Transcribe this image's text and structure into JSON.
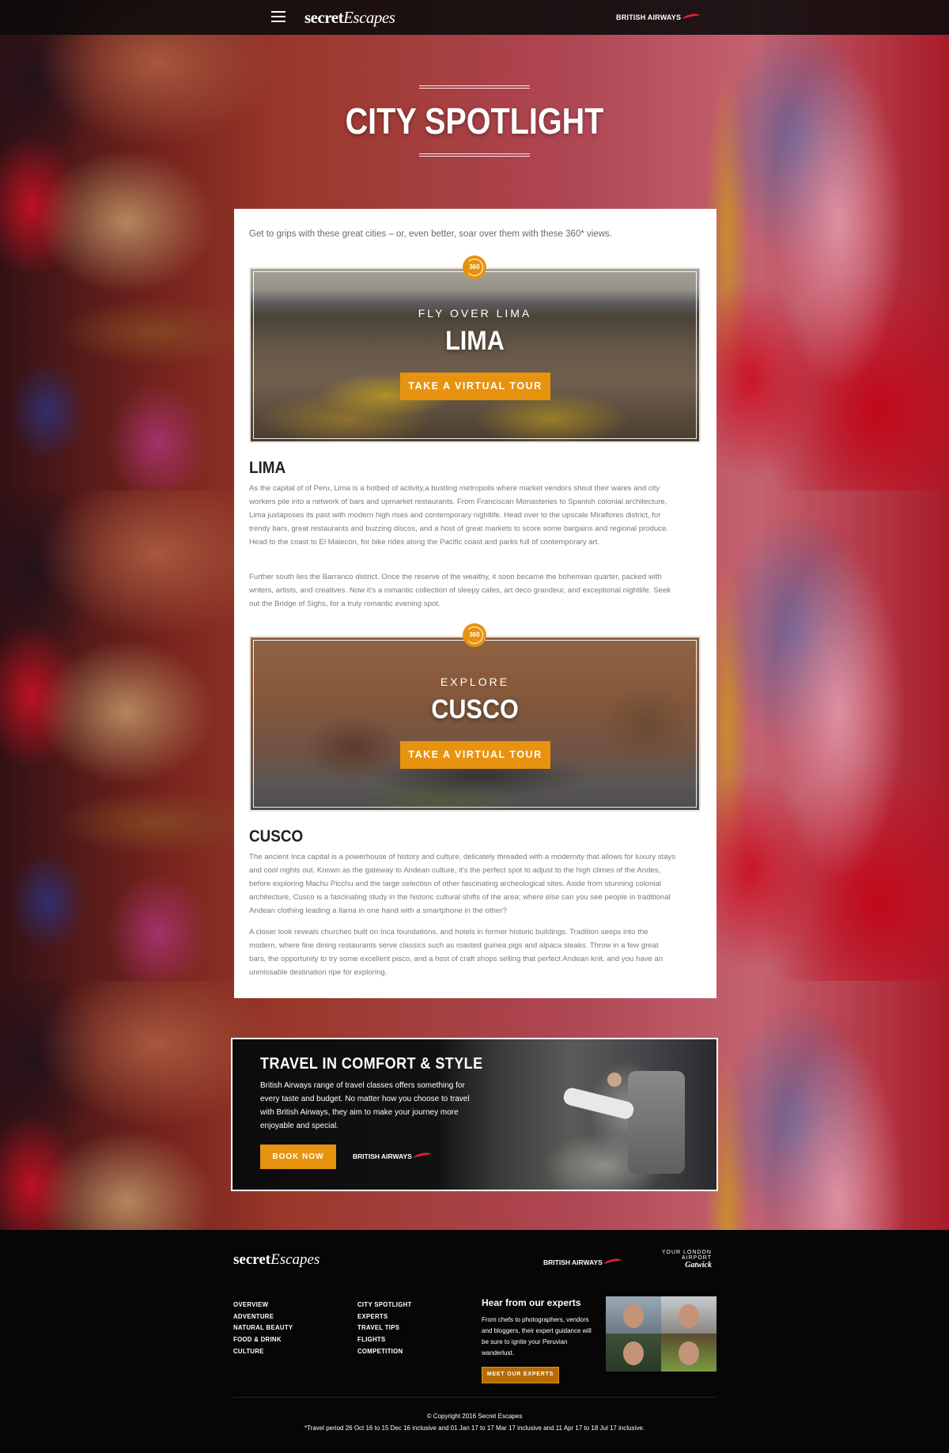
{
  "nav": {
    "brand_bold": "secret",
    "brand_italic": "Escapes",
    "partner_logo": "BRITISH AIRWAYS",
    "menu_icon": "hamburger-menu-icon"
  },
  "hero": {
    "title": "CITY SPOTLIGHT"
  },
  "content": {
    "intro": "Get to grips with these great cities – or, even better, soar over them with these 360* views.",
    "badge_label": "360",
    "lima": {
      "kicker": "FLY OVER LIMA",
      "city": "LIMA",
      "button": "TAKE A VIRTUAL TOUR",
      "heading": "LIMA",
      "para1": "As the capital of of Peru, Lima is a hotbed of activity,a bustling metropolis where market vendors shout their wares and city workers pile into a network of bars and upmarket restaurants. From Franciscan Monasteries to Spanish colonial architecture, Lima juxtaposes its past with modern high rises and contemporary nightlife. Head over to the upscale Miraflores district, for trendy bars, great restaurants and buzzing discos, and a host of great markets to score some bargains and regional produce. Head to the coast to El Malecón, for bike rides along the Pacific coast and parks full of contemporary art.",
      "para2": "Further south lies the Barranco district. Once the reserve of the wealthy, it soon became the bohemian quarter, packed with writers, artists, and creatives. Now it's a romantic collection of sleepy cafes, art deco grandeur, and exceptional nightlife. Seek out the Bridge of Sighs, for a truly romantic evening spot."
    },
    "cusco": {
      "kicker": "EXPLORE",
      "city": "CUSCO",
      "button": "TAKE A VIRTUAL TOUR",
      "heading": "CUSCO",
      "para1": "The ancient Inca capital is a powerhouse of history and culture, delicately threaded with a modernity that allows for luxury stays and cool nights out. Known as the gateway to Andean culture, it's the perfect spot to adjust to the high climes of the Andes, before exploring Machu Picchu and the large selection of other fascinating archeological sites. Aside from stunning colonial architecture, Cusco is a fascinating study in the historic cultural shifts of the area; where else can you see people in traditional Andean clothing leading a llama in one hand with a smartphone in the other?",
      "para2": "A closer look reveals churches built on Inca foundations, and hotels in former historic buildings. Tradition seeps into the modern, where fine dining restaurants serve classics such as roasted guinea pigs and alpaca steaks. Throw in a few great bars, the opportunity to try some excellent pisco, and a host of craft shops selling that perfect Andean knit, and you have an unmissable destination ripe for exploring."
    }
  },
  "promo": {
    "title": "TRAVEL IN COMFORT & STYLE",
    "text": "British Airways range of travel classes offers something for every taste and budget. No matter how you choose to travel with British Airways, they aim to make your journey more enjoyable and special.",
    "button": "BOOK NOW",
    "partner_logo": "BRITISH AIRWAYS"
  },
  "footer": {
    "brand_bold": "secret",
    "brand_italic": "Escapes",
    "partner_logo": "BRITISH AIRWAYS",
    "gatwick_top": "YOUR LONDON AIRPORT",
    "gatwick_bottom": "Gatwick",
    "col1": [
      "OVERVIEW",
      "ADVENTURE",
      "NATURAL BEAUTY",
      "FOOD & DRINK",
      "CULTURE"
    ],
    "col2": [
      "CITY SPOTLIGHT",
      "EXPERTS",
      "TRAVEL TIPS",
      "FLIGHTS",
      "COMPETITION"
    ],
    "experts_title": "Hear from our experts",
    "experts_text": "From chefs to photographers, vendors and bloggers, their expert guidance will be sure to ignite your Peruvian wanderlust.",
    "experts_button": "MEET OUR EXPERTS",
    "copyright": "© Copyright 2016 Secret Escapes",
    "travel_period": "*Travel period 26 Oct 16 to 15 Dec 16 inclusive and 01 Jan 17 to 17 Mar 17 inclusive and 11 Apr 17 to 18 Jul 17 inclusive."
  },
  "colors": {
    "accent": "#e8930f",
    "ba_red": "#e0242b",
    "footer_bg": "#060606"
  }
}
